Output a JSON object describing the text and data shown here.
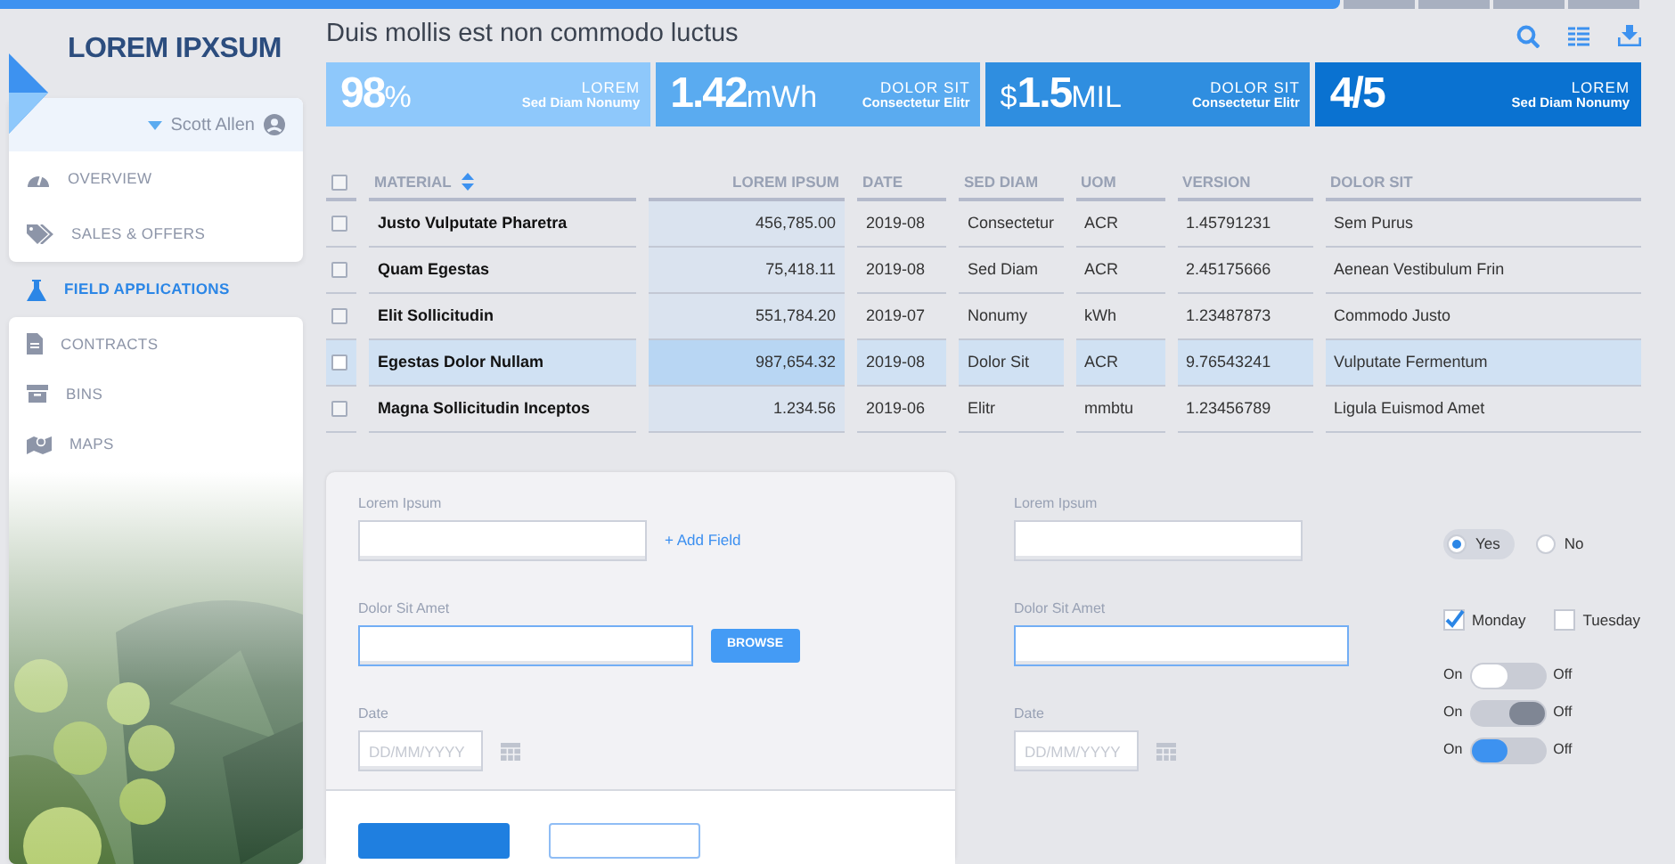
{
  "brand": "LOREM IPXSUM",
  "user": {
    "name": "Scott Allen"
  },
  "nav": [
    {
      "label": "OVERVIEW",
      "selected": false
    },
    {
      "label": "SALES & OFFERS",
      "selected": false
    },
    {
      "label": "FIELD APPLICATIONS",
      "selected": true
    },
    {
      "label": "CONTRACTS",
      "selected": false
    },
    {
      "label": "BINS",
      "selected": false
    },
    {
      "label": "MAPS",
      "selected": false
    }
  ],
  "page_title": "Duis mollis est non commodo luctus",
  "tiles": [
    {
      "big_text": "98",
      "unit": "%",
      "title": "LOREM",
      "subtitle": "Sed Diam Nonumy",
      "color": "#8ec8fb"
    },
    {
      "big_text": "1.42",
      "unit": "mWh",
      "title": "DOLOR SIT",
      "subtitle": "Consectetur Elitr",
      "color": "#5aabf0"
    },
    {
      "prefix": "$",
      "big_text": "1.5",
      "unit": "MIL",
      "title": "DOLOR SIT",
      "subtitle": "Consectetur Elitr",
      "color": "#2f8ee0"
    },
    {
      "big_text": "4/5",
      "title": "LOREM",
      "subtitle": "Sed Diam Nonumy",
      "color": "#0a72d1"
    }
  ],
  "table": {
    "select_all": {
      "checked": false
    },
    "columns": [
      {
        "label": "MATERIAL",
        "sortable": true,
        "shaded": false
      },
      {
        "label": "LOREM IPSUM",
        "sortable": false,
        "shaded": true
      },
      {
        "label": "DATE",
        "sortable": false,
        "shaded": false
      },
      {
        "label": "SED DIAM",
        "sortable": false,
        "shaded": false
      },
      {
        "label": "UOM",
        "sortable": false,
        "shaded": false
      },
      {
        "label": "VERSION",
        "sortable": false,
        "shaded": false
      },
      {
        "label": "DOLOR SIT",
        "sortable": false,
        "shaded": false
      }
    ],
    "rows": [
      {
        "checked": false,
        "selected": false,
        "cells": [
          "Justo Vulputate Pharetra",
          "456,785.00",
          "2019-08",
          "Consectetur",
          "ACR",
          "1.45791231",
          "Sem Purus"
        ]
      },
      {
        "checked": false,
        "selected": false,
        "cells": [
          "Quam Egestas",
          "75,418.11",
          "2019-08",
          "Sed Diam",
          "ACR",
          "2.45175666",
          "Aenean Vestibulum Frin"
        ]
      },
      {
        "checked": false,
        "selected": false,
        "cells": [
          "Elit Sollicitudin",
          "551,784.20",
          "2019-07",
          "Nonumy",
          "kWh",
          "1.23487873",
          "Commodo Justo"
        ]
      },
      {
        "checked": false,
        "selected": true,
        "cells": [
          "Egestas Dolor Nullam",
          "987,654.32",
          "2019-08",
          "Dolor Sit",
          "ACR",
          "9.76543241",
          "Vulputate Fermentum"
        ]
      },
      {
        "checked": false,
        "selected": false,
        "cells": [
          "Magna Sollicitudin Inceptos",
          "1.234.56",
          "2019-06",
          "Elitr",
          "mmbtu",
          "1.23456789",
          "Ligula Euismod Amet"
        ]
      }
    ]
  },
  "forms": [
    {
      "fields": [
        {
          "label": "Lorem Ipsum",
          "kind": "text",
          "focused": false,
          "action": "+ Add Field"
        },
        {
          "label": "Dolor Sit Amet",
          "kind": "text",
          "focused": true,
          "button": "BROWSE"
        },
        {
          "label": "Date",
          "kind": "date",
          "focused": false,
          "placeholder": "DD/MM/YYYY"
        }
      ]
    },
    {
      "fields": [
        {
          "label": "Lorem Ipsum",
          "kind": "text",
          "focused": false
        },
        {
          "label": "Dolor Sit Amet",
          "kind": "text",
          "focused": true
        },
        {
          "label": "Date",
          "kind": "date",
          "focused": false,
          "placeholder": "DD/MM/YYYY"
        }
      ]
    }
  ],
  "radios": [
    {
      "label": "Yes",
      "selected": true
    },
    {
      "label": "No",
      "selected": false
    }
  ],
  "checkboxes": [
    {
      "label": "Monday",
      "checked": true
    },
    {
      "label": "Tuesday",
      "checked": false
    }
  ],
  "toggles": [
    {
      "on_label": "On",
      "off_label": "Off",
      "on": true,
      "highlighted": false
    },
    {
      "on_label": "On",
      "off_label": "Off",
      "on": false,
      "highlighted": false
    },
    {
      "on_label": "On",
      "off_label": "Off",
      "on": true,
      "highlighted": true
    }
  ]
}
